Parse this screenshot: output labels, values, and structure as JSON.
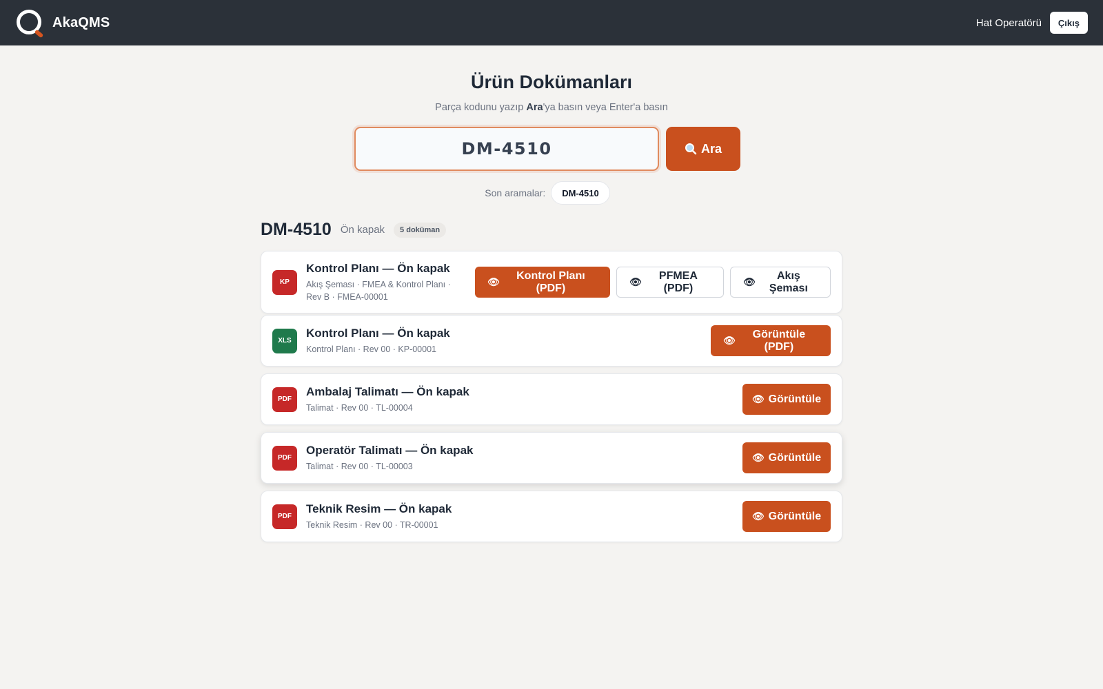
{
  "header": {
    "brand": "AkaQMS",
    "role": "Hat Operatörü",
    "logout_label": "Çıkış"
  },
  "page": {
    "title": "Ürün Dokümanları",
    "subtitle_pre": "Parça kodunu yazıp ",
    "subtitle_bold": "Ara",
    "subtitle_post": "'ya basın veya Enter'a basın"
  },
  "search": {
    "value": "DM-4510",
    "button_label": "Ara"
  },
  "recent": {
    "label": "Son aramalar:",
    "items": [
      "DM-4510"
    ]
  },
  "result": {
    "part_code": "DM-4510",
    "part_name": "Ön kapak",
    "count_label": "5 doküman"
  },
  "documents": [
    {
      "badge": "KP",
      "title": "Kontrol Planı — Ön kapak",
      "meta": "Akış Şeması · FMEA & Kontrol Planı · Rev B · FMEA-00001",
      "actions": [
        "Kontrol Planı (PDF)",
        "PFMEA (PDF)",
        "Akış Şeması"
      ]
    },
    {
      "badge": "XLS",
      "title": "Kontrol Planı — Ön kapak",
      "meta": "Kontrol Planı · Rev 00 · KP-00001",
      "actions": [
        "Görüntüle (PDF)"
      ]
    },
    {
      "badge": "PDF",
      "title": "Ambalaj Talimatı — Ön kapak",
      "meta": "Talimat · Rev 00 · TL-00004",
      "actions": [
        "Görüntüle"
      ]
    },
    {
      "badge": "PDF",
      "title": "Operatör Talimatı — Ön kapak",
      "meta": "Talimat · Rev 00 · TL-00003",
      "actions": [
        "Görüntüle"
      ]
    },
    {
      "badge": "PDF",
      "title": "Teknik Resim — Ön kapak",
      "meta": "Teknik Resim · Rev 00 · TR-00001",
      "actions": [
        "Görüntüle"
      ]
    }
  ],
  "colors": {
    "header_bg": "#2b3139",
    "accent": "#c9501e",
    "badge_red": "#c62828",
    "badge_green": "#1f7a4c",
    "page_bg": "#f4f3f1"
  },
  "icons": {
    "search": "magnifier-icon",
    "view": "eye-icon"
  }
}
